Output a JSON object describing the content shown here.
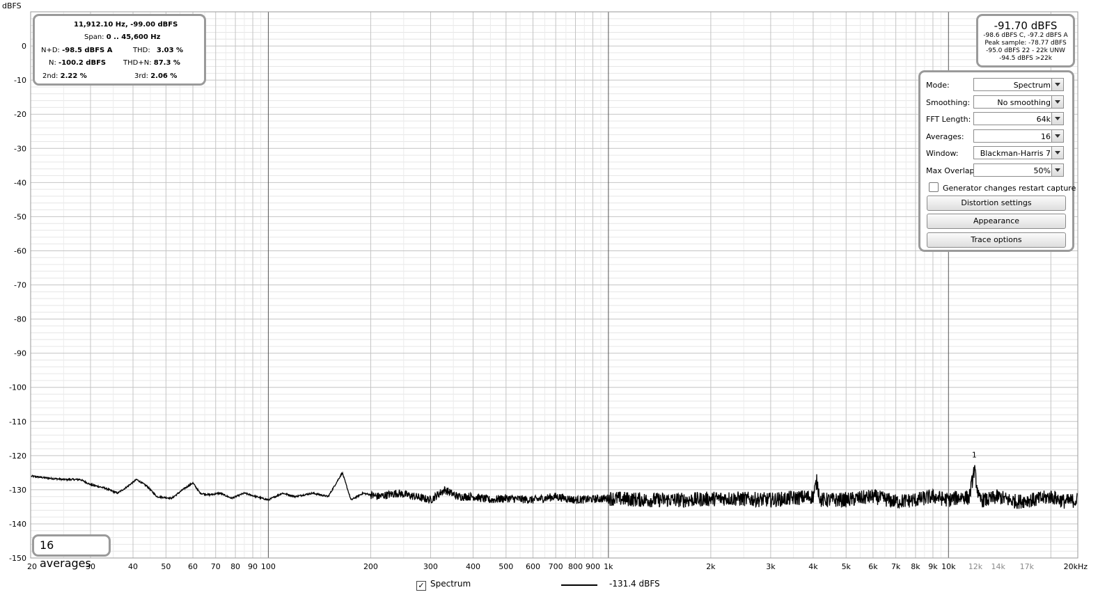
{
  "chart_data": {
    "type": "line",
    "ylabel": "dBFS",
    "xlabel": "",
    "xscale": "log",
    "xlim": [
      20,
      24000
    ],
    "ylim": [
      -150,
      10
    ],
    "grid": true,
    "y_ticks": [
      "0",
      "-10",
      "-20",
      "-30",
      "-40",
      "-50",
      "-60",
      "-70",
      "-80",
      "-90",
      "-100",
      "-110",
      "-120",
      "-130",
      "-140",
      "-150"
    ],
    "x_tick_labels": [
      {
        "v": 20,
        "t": "20"
      },
      {
        "v": 30,
        "t": "30"
      },
      {
        "v": 40,
        "t": "40"
      },
      {
        "v": 50,
        "t": "50"
      },
      {
        "v": 60,
        "t": "60"
      },
      {
        "v": 70,
        "t": "70"
      },
      {
        "v": 80,
        "t": "80"
      },
      {
        "v": 90,
        "t": "90"
      },
      {
        "v": 100,
        "t": "100"
      },
      {
        "v": 200,
        "t": "200"
      },
      {
        "v": 300,
        "t": "300"
      },
      {
        "v": 400,
        "t": "400"
      },
      {
        "v": 500,
        "t": "500"
      },
      {
        "v": 600,
        "t": "600"
      },
      {
        "v": 700,
        "t": "700"
      },
      {
        "v": 800,
        "t": "800"
      },
      {
        "v": 900,
        "t": "900"
      },
      {
        "v": 1000,
        "t": "1k"
      },
      {
        "v": 2000,
        "t": "2k"
      },
      {
        "v": 3000,
        "t": "3k"
      },
      {
        "v": 4000,
        "t": "4k"
      },
      {
        "v": 5000,
        "t": "5k"
      },
      {
        "v": 6000,
        "t": "6k"
      },
      {
        "v": 7000,
        "t": "7k"
      },
      {
        "v": 8000,
        "t": "8k"
      },
      {
        "v": 9000,
        "t": "9k"
      },
      {
        "v": 10000,
        "t": "10k"
      },
      {
        "v": 12000,
        "t": "12k"
      },
      {
        "v": 14000,
        "t": "14k"
      },
      {
        "v": 17000,
        "t": "17k"
      },
      {
        "v": 20000,
        "t": "20kHz"
      }
    ],
    "series": [
      {
        "color": "#000000",
        "x": [
          20,
          22,
          25,
          28,
          30,
          33,
          36,
          38,
          41,
          44,
          47,
          52,
          56,
          60,
          63,
          67,
          72,
          78,
          85,
          92,
          100,
          110,
          120,
          135,
          150,
          165,
          175,
          190,
          210,
          240,
          270,
          300,
          330,
          360,
          400,
          450,
          500,
          600,
          700,
          800,
          1000,
          1300,
          1700,
          2200,
          3000,
          4000,
          4100,
          4200,
          5000,
          6000,
          7000,
          8000,
          9000,
          10000,
          11000,
          11500,
          11912,
          12300,
          13000,
          14000,
          15000,
          16000,
          17000,
          18000,
          20000,
          22000,
          24000
        ],
        "y": [
          -126,
          -126.5,
          -127,
          -127,
          -128.5,
          -129.5,
          -131,
          -129.5,
          -127,
          -129,
          -132,
          -132.5,
          -130,
          -128,
          -131,
          -131.5,
          -131,
          -132.5,
          -131,
          -132,
          -133,
          -131,
          -132,
          -131,
          -132,
          -125,
          -133,
          -131,
          -132,
          -131,
          -132,
          -133,
          -130,
          -132,
          -132,
          -133,
          -132.5,
          -133,
          -132,
          -133,
          -132.5,
          -133,
          -133,
          -132.5,
          -133,
          -132,
          -127.5,
          -133,
          -133,
          -132,
          -133.5,
          -133,
          -132,
          -133,
          -132,
          -132.5,
          -124,
          -133,
          -133,
          -132,
          -133,
          -133.5,
          -133,
          -133,
          -132,
          -133.5,
          -133
        ]
      }
    ],
    "annotations": [
      {
        "text": "1",
        "x": 11912,
        "y": -120.5
      }
    ]
  },
  "info_panel": {
    "cursor": "11,912.10 Hz, -99.00 dBFS",
    "span_label": "Span:",
    "span_value": "0 .. 45,600 Hz",
    "nd_label": "N+D:",
    "nd_value": "-98.5 dBFS A",
    "thd_label": "THD:",
    "thd_value": "3.03 %",
    "n_label": "N:",
    "n_value": "-100.2 dBFS",
    "thdn_label": "THD+N:",
    "thdn_value": "87.3 %",
    "second_label": "2nd:",
    "second_value": "2.22 %",
    "third_label": "3rd:",
    "third_value": "2.06 %"
  },
  "level_panel": {
    "main": "-91.70 dBFS",
    "line1": "-98.6 dBFS C, -97.2 dBFS A",
    "line2": "Peak sample: -78.77 dBFS",
    "line3": "-95.0 dBFS 22 - 22k UNW",
    "line4": "-94.5 dBFS >22k"
  },
  "controls": {
    "mode_label": "Mode:",
    "mode_value": "Spectrum",
    "smoothing_label": "Smoothing:",
    "smoothing_value": "No  smoothing",
    "fft_label": "FFT Length:",
    "fft_value": "64k",
    "averages_label": "Averages:",
    "averages_value": "16",
    "window_label": "Window:",
    "window_value": "Blackman-Harris 7",
    "overlap_label": "Max Overlap:",
    "overlap_value": "50%",
    "generator_label": "Generator changes restart capture",
    "distortion_button": "Distortion settings",
    "appearance_button": "Appearance",
    "trace_button": "Trace options"
  },
  "averages_badge": "16 averages",
  "legend": {
    "check": "✓",
    "spectrum_label": "Spectrum",
    "level": "-131.4 dBFS"
  }
}
